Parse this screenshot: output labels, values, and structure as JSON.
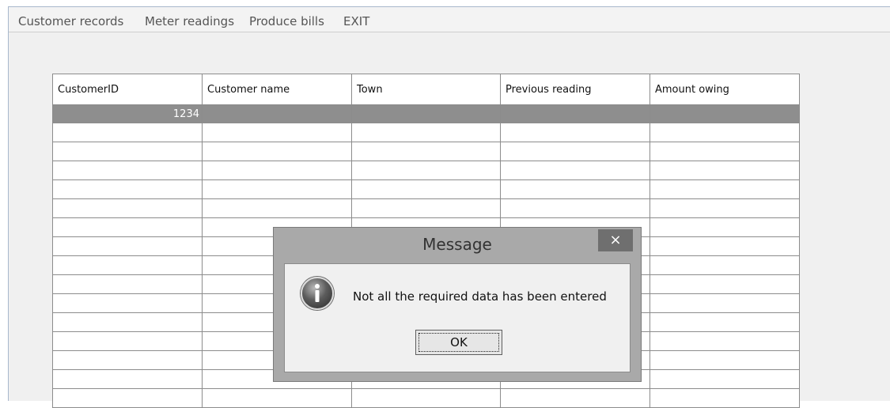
{
  "menu": {
    "items": [
      "Customer records",
      "Meter readings",
      "Produce bills",
      "EXIT"
    ]
  },
  "grid": {
    "columns": [
      "CustomerID",
      "Customer name",
      "Town",
      "Previous reading",
      "Amount owing"
    ],
    "selected_row": [
      "1234",
      "",
      "",
      "",
      ""
    ],
    "empty_rows": 15
  },
  "dialog": {
    "title": "Message",
    "close_glyph": "×",
    "message": "Not all the required data has been entered",
    "ok_label": "OK",
    "icon": "info-icon"
  }
}
